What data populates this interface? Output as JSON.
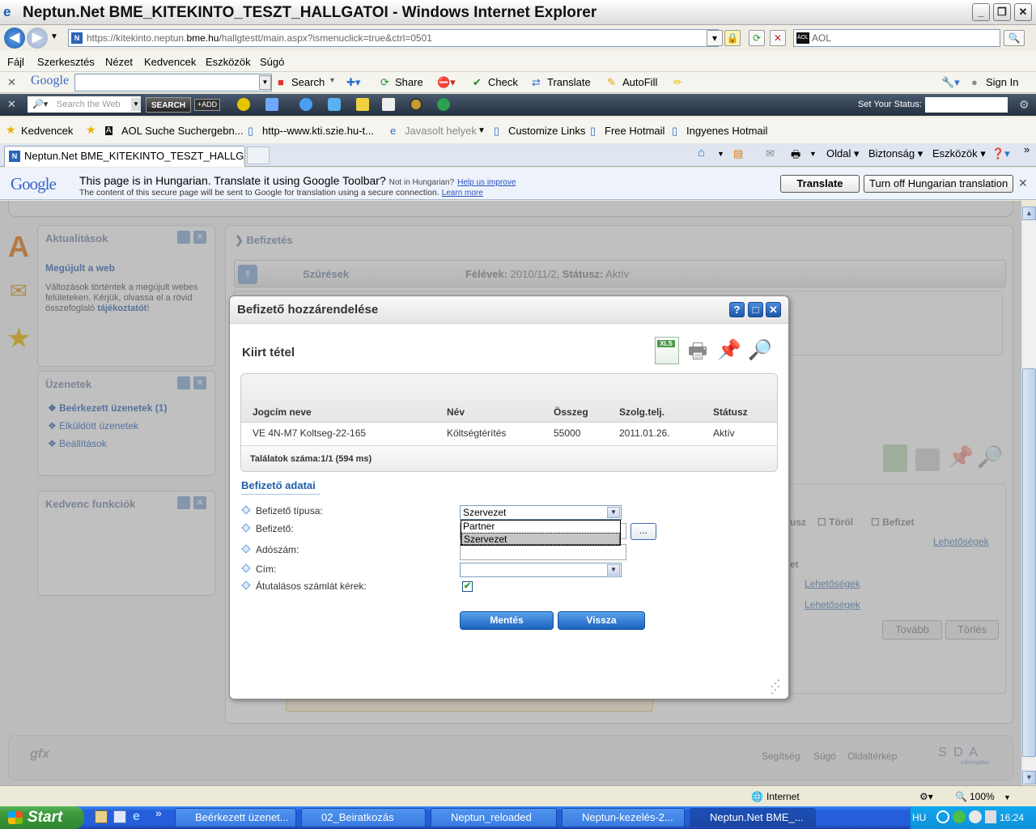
{
  "window": {
    "title": "Neptun.Net BME_KITEKINTO_TESZT_HALLGATOI - Windows Internet Explorer"
  },
  "address": {
    "url_prefix": "https://",
    "url_host_a": "kitekinto.neptun.",
    "url_host_b": "bme.hu",
    "url_path": "/hallgtestt/main.aspx?ismenuclick=true&ctrl=0501",
    "search_placeholder": "AOL"
  },
  "menu": [
    "Fájl",
    "Szerkesztés",
    "Nézet",
    "Kedvencek",
    "Eszközök",
    "Súgó"
  ],
  "google_toolbar": {
    "logo": "Google",
    "search": "Search",
    "share": "Share",
    "check": "Check",
    "translate": "Translate",
    "autofill": "AutoFill",
    "signin": "Sign In"
  },
  "aol_bar": {
    "search_placeholder": "Search the Web",
    "search_button": "SEARCH",
    "add_button": "+ADD",
    "status_label": "Set Your Status:"
  },
  "favorites": {
    "label": "Kedvencek",
    "items": [
      "AOL Suche Suchergebn...",
      "http--www.kti.szie.hu-t...",
      "Javasolt helyek",
      "Customize Links",
      "Free Hotmail",
      "Ingyenes Hotmail"
    ]
  },
  "tabs": {
    "active": "Neptun.Net BME_KITEKINTO_TESZT_HALLGA...",
    "cmd_oldal": "Oldal",
    "cmd_biztonsag": "Biztonság",
    "cmd_eszkozok": "Eszközök"
  },
  "translate_bar": {
    "logo": "Google",
    "message": "This page is in Hungarian.  Translate it using Google Toolbar?",
    "not_lang": "Not in Hungarian?",
    "help_link": "Help us improve",
    "secure_note": "The content of this secure page will be sent to Google for translation using a secure connection.",
    "learn_more": "Learn more",
    "translate_btn": "Translate",
    "turnoff_btn": "Turn off Hungarian translation"
  },
  "page": {
    "aktualitasok": {
      "title": "Aktualitások",
      "subtitle": "Megújult a web",
      "text": "Változások történtek a megújult webes felületeken. Kérjük, olvassa el a rövid összefoglaló",
      "link": "tájékoztatót",
      "after": "!"
    },
    "uzenetek": {
      "title": "Üzenetek",
      "items": [
        "Beérkezett üzenetek (1)",
        "Elküldött üzenetek",
        "Beállítások"
      ]
    },
    "kedvenc": {
      "title": "Kedvenc funkciók"
    },
    "main_title": "Befizetés",
    "filter": {
      "label": "Szűrések",
      "felevek_label": "Félévek:",
      "felevek_value": "2010/11/2,",
      "status_label": "Státusz:",
      "status_value": "Aktív"
    },
    "bg": {
      "torol": "Töröl",
      "befizet": "Befizet",
      "lehetosegek": "Lehetőségek",
      "tovabb": "Tovább",
      "torles": "Törlés",
      "usz": "usz",
      "et": "et"
    },
    "footer": {
      "links": [
        "Segítség",
        "Súgó",
        "Oldaltérkép"
      ],
      "logo_left": "gfx",
      "logo_right": "S D A",
      "logo_sub": "Informatika"
    }
  },
  "dialog": {
    "title": "Befizető hozzárendelése",
    "section": "Kiirt tétel",
    "columns": [
      "Jogcím neve",
      "Név",
      "Összeg",
      "Szolg.telj.",
      "Státusz"
    ],
    "rows": [
      [
        "VE 4N-M7 Koltseg-22-165",
        "Költségtérítés",
        "55000",
        "2011.01.26.",
        "Aktív"
      ]
    ],
    "count": "Találatok száma:1/1 (594 ms)",
    "form_title": "Befizető adatai",
    "fields": {
      "tipus": "Befizető típusa:",
      "befizeto": "Befizető:",
      "adoszam": "Adószám:",
      "cim": "Cím:",
      "atutalas": "Átutalásos számlát kérek:"
    },
    "tipus_value": "Szervezet",
    "dropdown_options": [
      "Partner",
      "Szervezet"
    ],
    "dots": "...",
    "save": "Mentés",
    "back": "Vissza"
  },
  "statusbar": {
    "zone": "Internet",
    "zoom": "100%"
  },
  "taskbar": {
    "start": "Start",
    "tasks": [
      "Beérkezett üzenet...",
      "02_Beiratkozás",
      "Neptun_reloaded",
      "Neptun-kezelés-2...",
      "Neptun.Net BME_..."
    ],
    "lang": "HU",
    "clock": "16:24"
  }
}
